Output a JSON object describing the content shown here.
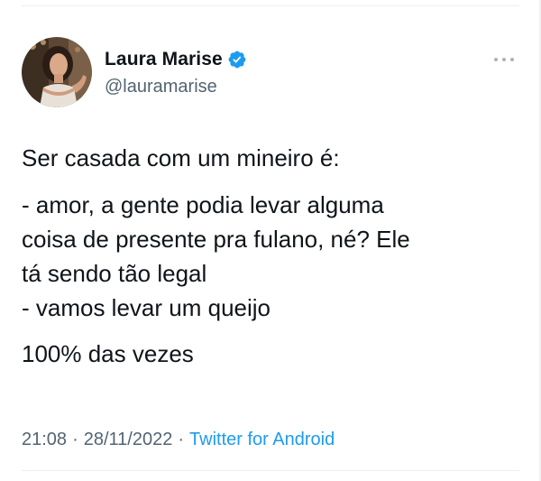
{
  "author": {
    "display_name": "Laura Marise",
    "handle": "@lauramarise",
    "verified": true,
    "badge_color": "#1d9bf0"
  },
  "tweet": {
    "paragraphs": [
      "Ser casada com um mineiro é:",
      [
        "- amor, a gente podia levar alguma",
        "coisa de presente pra fulano, né? Ele",
        "tá sendo tão legal",
        "- vamos levar um queijo"
      ],
      "100% das vezes"
    ],
    "lines": {
      "p1": "Ser casada com um mineiro é:",
      "p2_l1": "- amor, a gente podia levar alguma",
      "p2_l2": "coisa de presente pra fulano, né? Ele",
      "p2_l3": "tá sendo tão legal",
      "p2_l4": "- vamos levar um queijo",
      "p3": "100% das vezes"
    }
  },
  "meta": {
    "time": "21:08",
    "separator": "·",
    "date": "28/11/2022",
    "source": "Twitter for Android"
  },
  "icons": {
    "more": "more-horizontal-icon",
    "verified": "verified-badge-icon"
  },
  "colors": {
    "text_primary": "#0f1419",
    "text_secondary": "#536471",
    "accent": "#1d9bf0"
  }
}
